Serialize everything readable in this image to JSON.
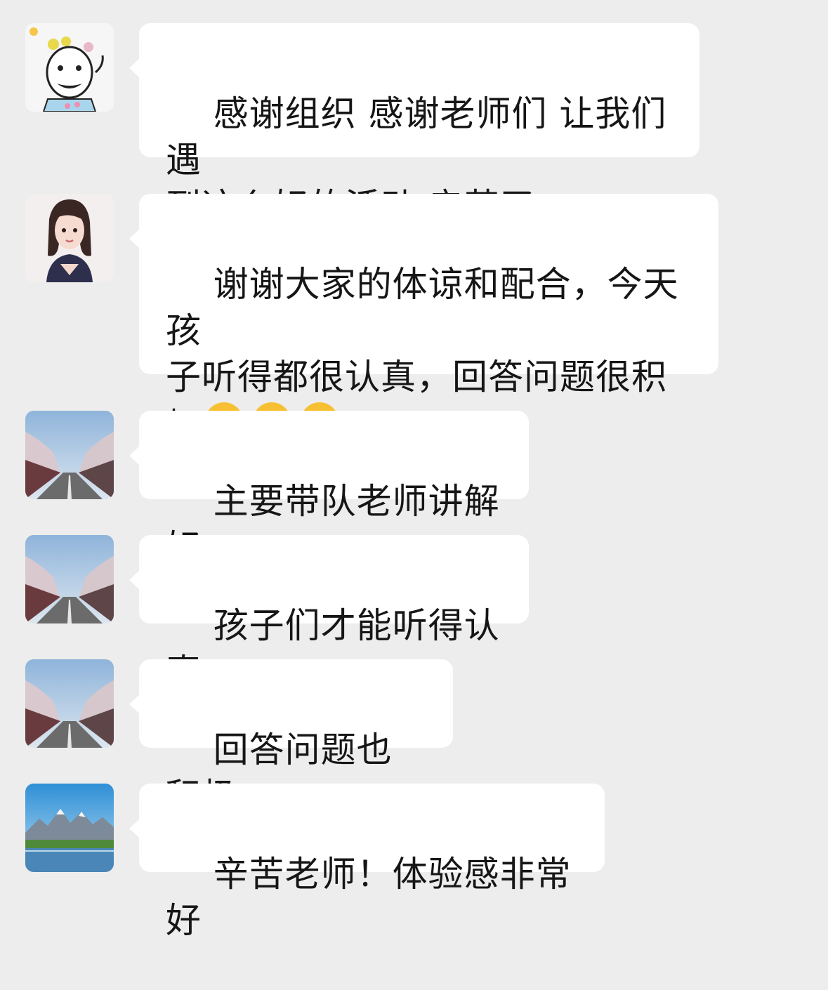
{
  "messages": [
    {
      "avatar": "cartoon-drawing-avatar",
      "text": "感谢组织 感谢老师们 让我们遇\n到这么好的活动 辛苦了～"
    },
    {
      "avatar": "illustrated-woman-avatar",
      "text": "谢谢大家的体谅和配合，今天孩\n子听得都很认真，回答问题很积\n极",
      "emoji": [
        "hand-over-mouth-icon",
        "hand-over-mouth-icon",
        "hand-over-mouth-icon"
      ]
    },
    {
      "avatar": "cherry-blossom-road-avatar",
      "text": "主要带队老师讲解好"
    },
    {
      "avatar": "cherry-blossom-road-avatar",
      "text": "孩子们才能听得认真"
    },
    {
      "avatar": "cherry-blossom-road-avatar",
      "text": "回答问题也积极"
    },
    {
      "avatar": "mountain-lake-avatar",
      "text": "辛苦老师！体验感非常好"
    }
  ]
}
